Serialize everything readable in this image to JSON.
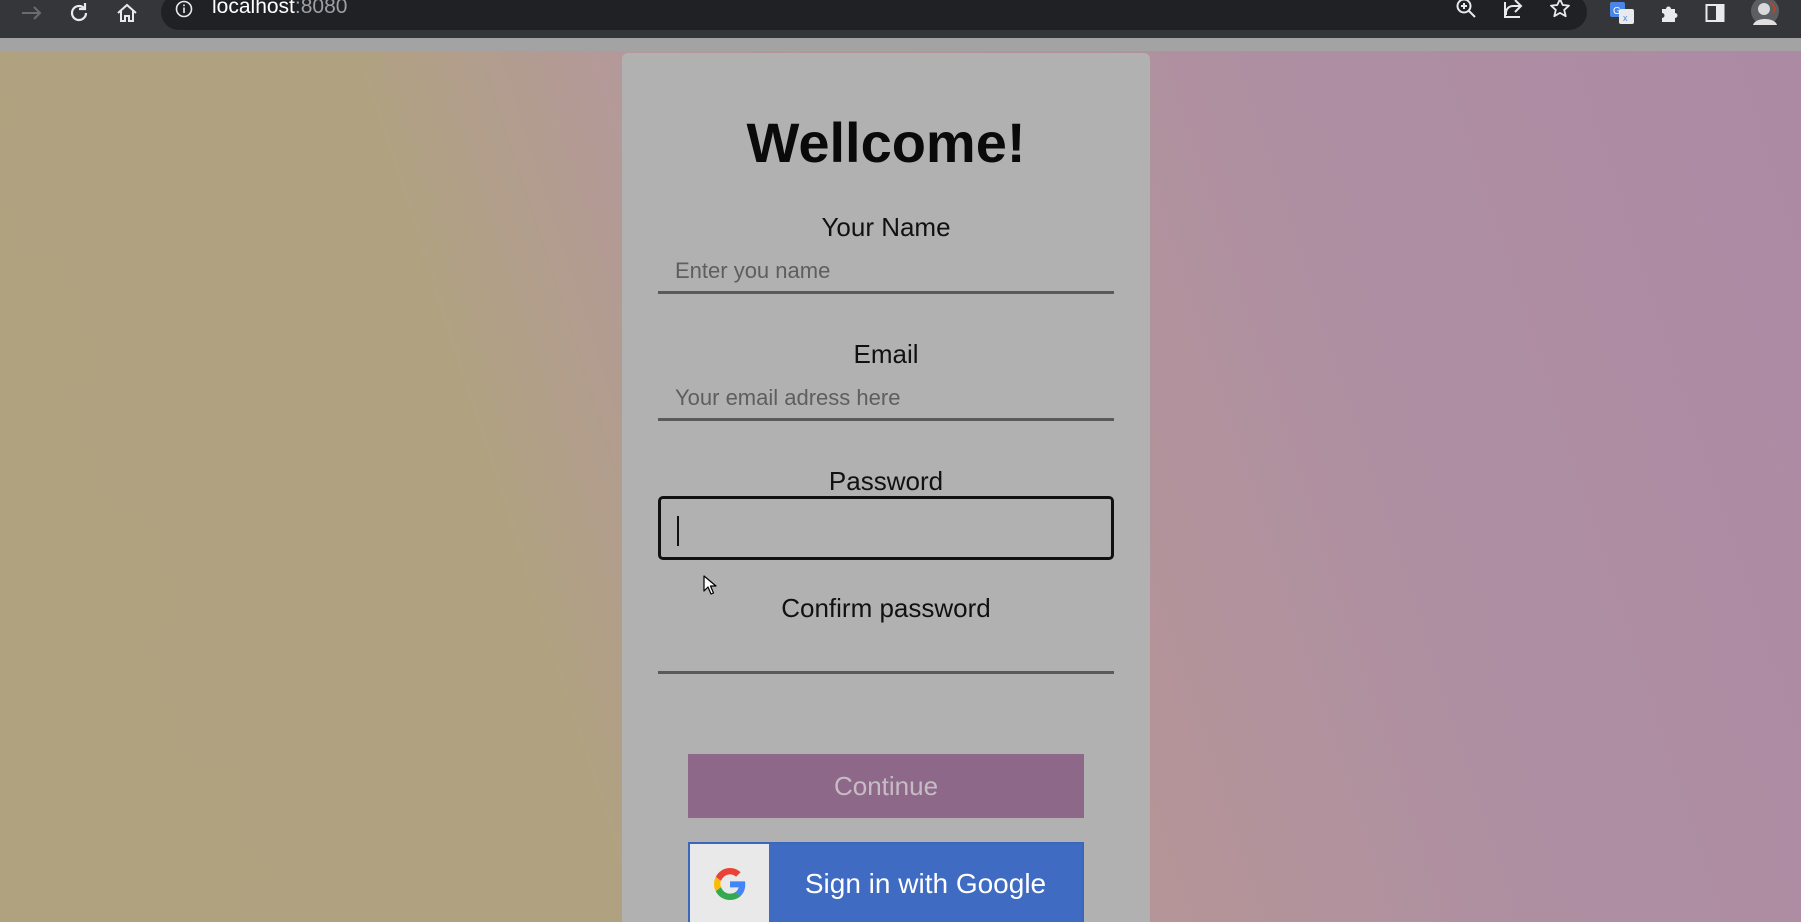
{
  "browser": {
    "url_host": "localhost",
    "url_port": ":8080",
    "icons": [
      "forward-icon",
      "reload-icon",
      "home-icon",
      "info-icon",
      "zoom-icon",
      "share-icon",
      "bookmark-star-icon",
      "translate-icon",
      "extensions-icon",
      "side-panel-icon",
      "profile-avatar"
    ]
  },
  "form": {
    "title": "Wellcome!",
    "name_label": "Your Name",
    "name_placeholder": "Enter you name",
    "email_label": "Email",
    "email_placeholder": "Your email adress here",
    "password_label": "Password",
    "password_value": "",
    "confirm_label": "Confirm password",
    "confirm_value": "",
    "continue_label": "Continue",
    "google_label": "Sign in with Google"
  },
  "colors": {
    "card": "#b1b1b1",
    "continue_button": "#8e6889",
    "google_button": "#3f6bc2"
  }
}
